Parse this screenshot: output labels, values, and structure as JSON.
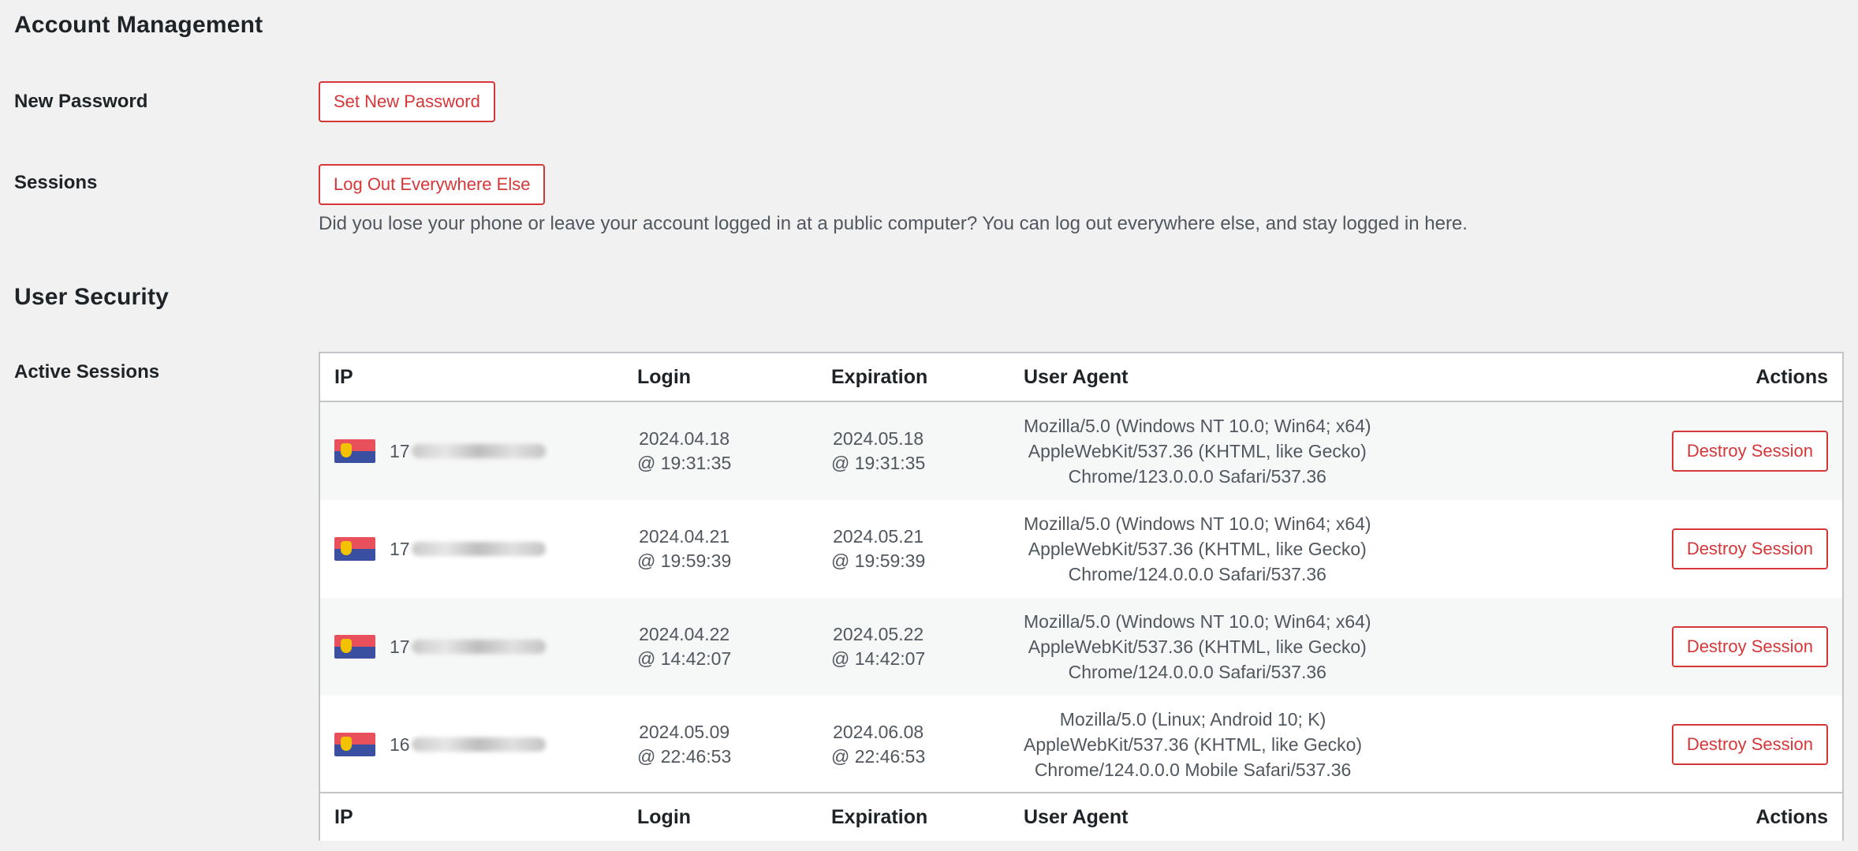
{
  "account_management": {
    "title": "Account Management",
    "new_password": {
      "label": "New Password",
      "button": "Set New Password"
    },
    "sessions": {
      "label": "Sessions",
      "button": "Log Out Everywhere Else",
      "description": "Did you lose your phone or leave your account logged in at a public computer? You can log out everywhere else, and stay logged in here."
    }
  },
  "user_security": {
    "title": "User Security",
    "active_sessions_label": "Active Sessions",
    "table": {
      "headers": {
        "ip": "IP",
        "login": "Login",
        "expiration": "Expiration",
        "user_agent": "User Agent",
        "actions": "Actions"
      },
      "rows": [
        {
          "ip_prefix": "17",
          "login_date": "2024.04.18",
          "login_time": "@ 19:31:35",
          "exp_date": "2024.05.18",
          "exp_time": "@ 19:31:35",
          "ua_line1": "Mozilla/5.0 (Windows NT 10.0; Win64; x64)",
          "ua_line2": "AppleWebKit/537.36 (KHTML, like Gecko)",
          "ua_line3": "Chrome/123.0.0.0 Safari/537.36",
          "action": "Destroy Session"
        },
        {
          "ip_prefix": "17",
          "login_date": "2024.04.21",
          "login_time": "@ 19:59:39",
          "exp_date": "2024.05.21",
          "exp_time": "@ 19:59:39",
          "ua_line1": "Mozilla/5.0 (Windows NT 10.0; Win64; x64)",
          "ua_line2": "AppleWebKit/537.36 (KHTML, like Gecko)",
          "ua_line3": "Chrome/124.0.0.0 Safari/537.36",
          "action": "Destroy Session"
        },
        {
          "ip_prefix": "17",
          "login_date": "2024.04.22",
          "login_time": "@ 14:42:07",
          "exp_date": "2024.05.22",
          "exp_time": "@ 14:42:07",
          "ua_line1": "Mozilla/5.0 (Windows NT 10.0; Win64; x64)",
          "ua_line2": "AppleWebKit/537.36 (KHTML, like Gecko)",
          "ua_line3": "Chrome/124.0.0.0 Safari/537.36",
          "action": "Destroy Session"
        },
        {
          "ip_prefix": "16",
          "login_date": "2024.05.09",
          "login_time": "@ 22:46:53",
          "exp_date": "2024.06.08",
          "exp_time": "@ 22:46:53",
          "ua_line1": "Mozilla/5.0 (Linux; Android 10; K)",
          "ua_line2": "AppleWebKit/537.36 (KHTML, like Gecko)",
          "ua_line3": "Chrome/124.0.0.0 Mobile Safari/537.36",
          "action": "Destroy Session"
        }
      ]
    }
  },
  "colors": {
    "page_bg": "#f1f1f1",
    "accent_red": "#d63638",
    "text_dark": "#1d2327",
    "text_muted": "#50575e",
    "border": "#c3c4c7",
    "row_alt_bg": "#f6f7f7"
  },
  "icons": {
    "ip_flag": "country-flag-icon"
  }
}
